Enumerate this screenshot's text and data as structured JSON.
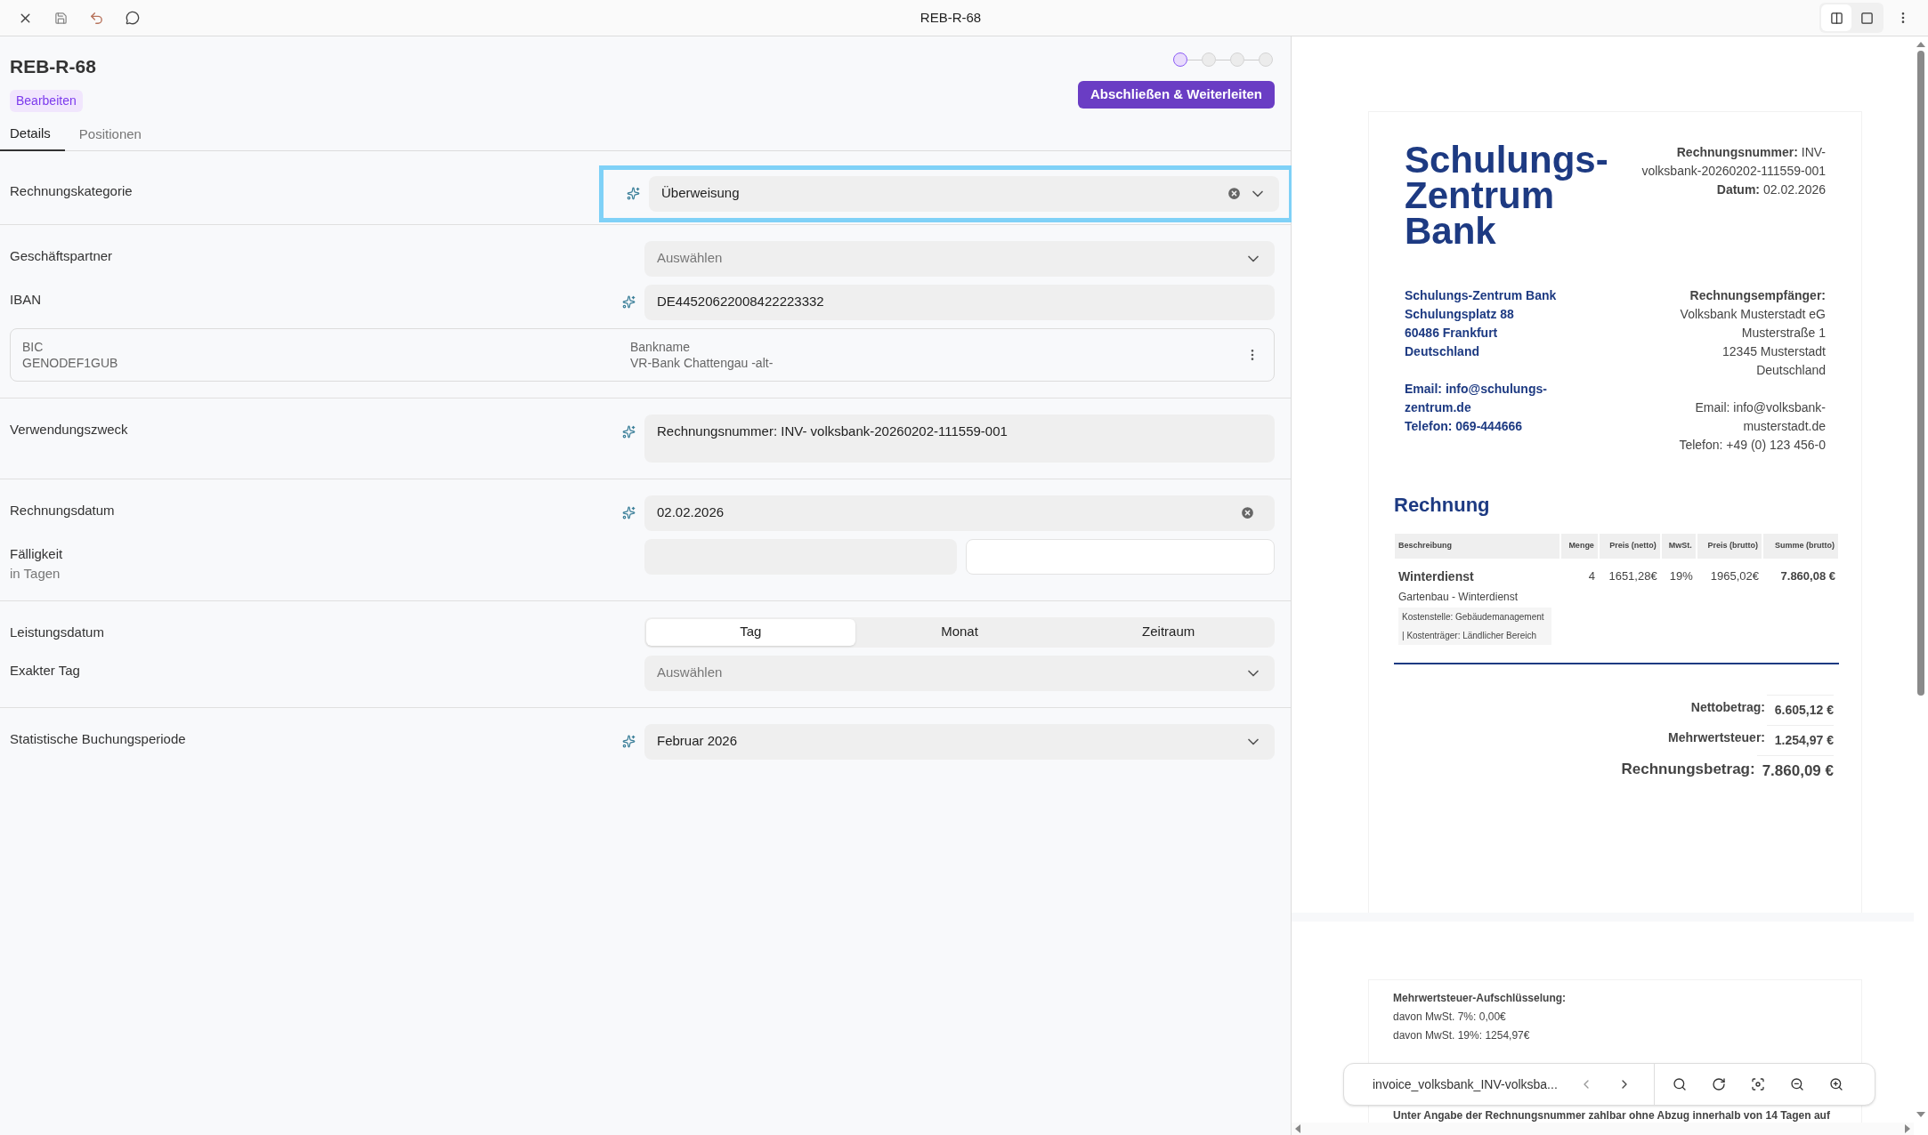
{
  "toolbar": {
    "title": "REB-R-68",
    "view_toggle": [
      {
        "selected": true
      },
      {
        "selected": false
      }
    ]
  },
  "header": {
    "title": "REB-R-68",
    "status": "Bearbeiten",
    "steps": [
      {
        "selected": true
      },
      {
        "selected": false
      },
      {
        "selected": false
      },
      {
        "selected": false
      }
    ],
    "primary_button": "Abschließen & Weiterleiten"
  },
  "tabs": [
    {
      "label": "Details",
      "selected": true
    },
    {
      "label": "Positionen",
      "selected": false
    }
  ],
  "sections": [
    {
      "fields": [
        {
          "kind": "select",
          "label": "Rechnungskategorie",
          "value": "Überweisung",
          "ai": true,
          "clearable": true,
          "highlighted": true
        }
      ]
    },
    {
      "fields": [
        {
          "kind": "select",
          "label": "Geschäftspartner",
          "placeholder": "Auswählen",
          "ai": false,
          "clearable": false,
          "highlighted": false
        },
        {
          "kind": "text",
          "label": "IBAN",
          "value": "DE44520622008422223332",
          "ai": true,
          "clearable": false
        },
        {
          "kind": "bank",
          "bic_label": "BIC",
          "bic": "GENODEF1GUB",
          "name_label": "Bankname",
          "name": "VR-Bank Chattengau -alt-"
        }
      ]
    },
    {
      "fields": [
        {
          "kind": "textarea",
          "label": "Verwendungszweck",
          "value": "Rechnungsnummer: INV- volksbank-20260202-111559-001",
          "ai": true
        }
      ]
    },
    {
      "fields": [
        {
          "kind": "text",
          "label": "Rechnungsdatum",
          "value": "02.02.2026",
          "ai": true,
          "clearable": true
        },
        {
          "kind": "pair",
          "label": "Fälligkeit",
          "sublabel": "in Tagen"
        }
      ]
    },
    {
      "fields": [
        {
          "kind": "segmented",
          "label": "Leistungsdatum",
          "options": [
            {
              "label": "Tag",
              "selected": true
            },
            {
              "label": "Monat",
              "selected": false
            },
            {
              "label": "Zeitraum",
              "selected": false
            }
          ]
        },
        {
          "kind": "select",
          "label": "Exakter Tag",
          "placeholder": "Auswählen",
          "ai": false,
          "clearable": false,
          "highlighted": false
        }
      ]
    },
    {
      "fields": [
        {
          "kind": "select",
          "label": "Statistische Buchungsperiode",
          "value": "Februar 2026",
          "ai": true,
          "clearable": false,
          "highlighted": false
        }
      ]
    }
  ],
  "document": {
    "logo_lines": [
      "Schulungs-",
      "Zentrum",
      "Bank"
    ],
    "meta": [
      "**Rechnungsnummer:** INV-volksbank-20260202-111559-001",
      "**Datum:** 02.02.2026"
    ],
    "sender": [
      "Schulungs-Zentrum Bank",
      "Schulungsplatz 88",
      "60486 Frankfurt",
      "Deutschland"
    ],
    "sender_contact": [
      "Email: info@schulungs-zentrum.de",
      "Telefon: 069-444666"
    ],
    "recipient_heading": "Rechnungsempfänger:",
    "recipient": [
      "Volksbank Musterstadt eG",
      "Musterstraße 1",
      "12345 Musterstadt",
      "Deutschland"
    ],
    "recipient_contact": [
      "Email: info@volksbank-musterstadt.de",
      "Telefon: +49 (0) 123 456-0"
    ],
    "heading": "Rechnung",
    "columns": [
      "Beschreibung",
      "Menge",
      "Preis (netto)",
      "MwSt.",
      "Preis (brutto)",
      "Summe (brutto)"
    ],
    "rows": [
      {
        "subtitle": "Gartenbau - Winterdienst",
        "note": "Kostenstelle: Gebäudemanagement | Kostenträger: Ländlicher Bereich",
        "cells": [
          "Winterdienst",
          "4",
          "1651,28€",
          "19%",
          "1965,02€",
          "7.860,08 €"
        ]
      }
    ],
    "totals": [
      {
        "label": "Nettobetrag:",
        "value": "6.605,12 €",
        "grand": false
      },
      {
        "label": "Mehrwertsteuer:",
        "value": "1.254,97 €",
        "grand": false
      },
      {
        "label": "Rechnungsbetrag:",
        "value": "7.860,09 €",
        "grand": true
      }
    ],
    "vat_heading": "Mehrwertsteuer-Aufschlüsselung:",
    "vat_lines": [
      "davon MwSt. 7%: 0,00€",
      "davon MwSt. 19%: 1254,97€"
    ],
    "footer": "Unter Angabe der Rechnungsnummer zahlbar ohne Abzug innerhalb von 14 Tagen auf"
  },
  "viewer": {
    "filename": "invoice_volksbank_INV-volksba..."
  }
}
